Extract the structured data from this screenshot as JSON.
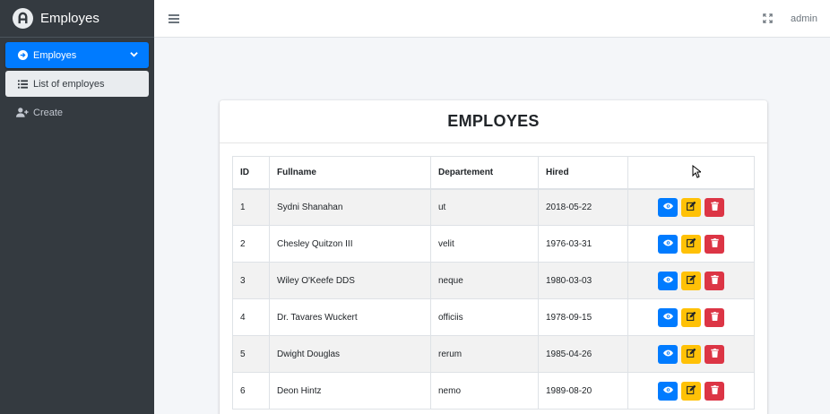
{
  "brand": {
    "title": "Employes",
    "logo_icon": "app-logo-icon"
  },
  "sidebar": {
    "items": [
      {
        "label": "Employes",
        "icon": "circle-arrow-right-icon",
        "active": true
      },
      {
        "label": "List of employes",
        "icon": "list-icon"
      },
      {
        "label": "Create",
        "icon": "user-plus-icon"
      }
    ]
  },
  "topbar": {
    "user": "admin"
  },
  "card": {
    "title": "EMPLOYES"
  },
  "table": {
    "headers": [
      "ID",
      "Fullname",
      "Departement",
      "Hired",
      ""
    ],
    "rows": [
      {
        "id": "1",
        "fullname": "Sydni Shanahan",
        "department": "ut",
        "hired": "2018-05-22"
      },
      {
        "id": "2",
        "fullname": "Chesley Quitzon III",
        "department": "velit",
        "hired": "1976-03-31"
      },
      {
        "id": "3",
        "fullname": "Wiley O'Keefe DDS",
        "department": "neque",
        "hired": "1980-03-03"
      },
      {
        "id": "4",
        "fullname": "Dr. Tavares Wuckert",
        "department": "officiis",
        "hired": "1978-09-15"
      },
      {
        "id": "5",
        "fullname": "Dwight Douglas",
        "department": "rerum",
        "hired": "1985-04-26"
      },
      {
        "id": "6",
        "fullname": "Deon Hintz",
        "department": "nemo",
        "hired": "1989-08-20"
      }
    ]
  },
  "colors": {
    "sidebar": "#343a40",
    "primary": "#007bff",
    "warning": "#ffc107",
    "danger": "#dc3545"
  }
}
